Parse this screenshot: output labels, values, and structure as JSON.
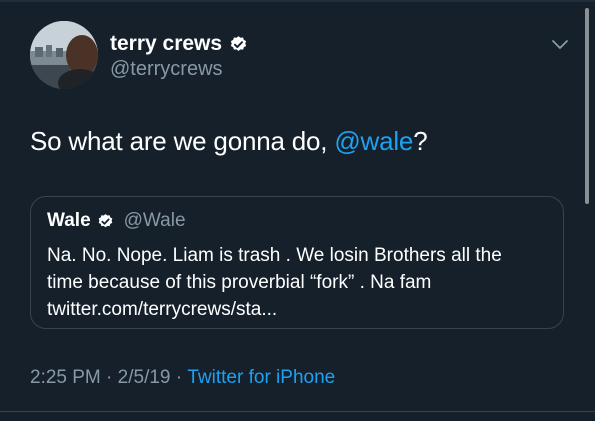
{
  "tweet": {
    "author": {
      "display_name": "terry crews",
      "handle": "@terrycrews",
      "verified": true
    },
    "text_prefix": "So what are we gonna do, ",
    "mention": "@wale",
    "text_suffix": "?",
    "quoted": {
      "display_name": "Wale",
      "handle": "@Wale",
      "verified": true,
      "lines": [
        "Na. No. Nope. Liam is trash . We losin Brothers all the",
        "time because of this proverbial “fork” . Na fam",
        "twitter.com/terrycrews/sta..."
      ]
    },
    "time": "2:25 PM",
    "sep1": " · ",
    "date": "2/5/19",
    "sep2": " · ",
    "source": "Twitter for iPhone"
  },
  "icons": {
    "verified": "verified-badge-icon",
    "more": "chevron-down-icon"
  },
  "colors": {
    "background": "#15202b",
    "accent": "#1da1f2",
    "secondary_text": "#8899a6",
    "border": "#38444d"
  }
}
